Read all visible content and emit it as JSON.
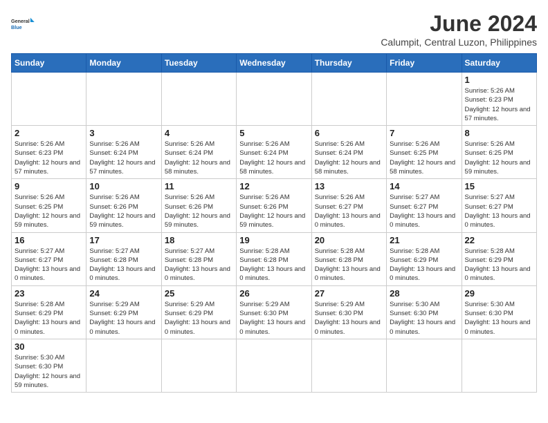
{
  "logo": {
    "text_general": "General",
    "text_blue": "Blue"
  },
  "header": {
    "title": "June 2024",
    "subtitle": "Calumpit, Central Luzon, Philippines"
  },
  "weekdays": [
    "Sunday",
    "Monday",
    "Tuesday",
    "Wednesday",
    "Thursday",
    "Friday",
    "Saturday"
  ],
  "weeks": [
    [
      {
        "day": "",
        "info": ""
      },
      {
        "day": "",
        "info": ""
      },
      {
        "day": "",
        "info": ""
      },
      {
        "day": "",
        "info": ""
      },
      {
        "day": "",
        "info": ""
      },
      {
        "day": "",
        "info": ""
      },
      {
        "day": "1",
        "info": "Sunrise: 5:26 AM\nSunset: 6:23 PM\nDaylight: 12 hours\nand 57 minutes."
      }
    ],
    [
      {
        "day": "2",
        "info": "Sunrise: 5:26 AM\nSunset: 6:23 PM\nDaylight: 12 hours\nand 57 minutes."
      },
      {
        "day": "3",
        "info": "Sunrise: 5:26 AM\nSunset: 6:24 PM\nDaylight: 12 hours\nand 57 minutes."
      },
      {
        "day": "4",
        "info": "Sunrise: 5:26 AM\nSunset: 6:24 PM\nDaylight: 12 hours\nand 58 minutes."
      },
      {
        "day": "5",
        "info": "Sunrise: 5:26 AM\nSunset: 6:24 PM\nDaylight: 12 hours\nand 58 minutes."
      },
      {
        "day": "6",
        "info": "Sunrise: 5:26 AM\nSunset: 6:24 PM\nDaylight: 12 hours\nand 58 minutes."
      },
      {
        "day": "7",
        "info": "Sunrise: 5:26 AM\nSunset: 6:25 PM\nDaylight: 12 hours\nand 58 minutes."
      },
      {
        "day": "8",
        "info": "Sunrise: 5:26 AM\nSunset: 6:25 PM\nDaylight: 12 hours\nand 59 minutes."
      }
    ],
    [
      {
        "day": "9",
        "info": "Sunrise: 5:26 AM\nSunset: 6:25 PM\nDaylight: 12 hours\nand 59 minutes."
      },
      {
        "day": "10",
        "info": "Sunrise: 5:26 AM\nSunset: 6:26 PM\nDaylight: 12 hours\nand 59 minutes."
      },
      {
        "day": "11",
        "info": "Sunrise: 5:26 AM\nSunset: 6:26 PM\nDaylight: 12 hours\nand 59 minutes."
      },
      {
        "day": "12",
        "info": "Sunrise: 5:26 AM\nSunset: 6:26 PM\nDaylight: 12 hours\nand 59 minutes."
      },
      {
        "day": "13",
        "info": "Sunrise: 5:26 AM\nSunset: 6:27 PM\nDaylight: 13 hours\nand 0 minutes."
      },
      {
        "day": "14",
        "info": "Sunrise: 5:27 AM\nSunset: 6:27 PM\nDaylight: 13 hours\nand 0 minutes."
      },
      {
        "day": "15",
        "info": "Sunrise: 5:27 AM\nSunset: 6:27 PM\nDaylight: 13 hours\nand 0 minutes."
      }
    ],
    [
      {
        "day": "16",
        "info": "Sunrise: 5:27 AM\nSunset: 6:27 PM\nDaylight: 13 hours\nand 0 minutes."
      },
      {
        "day": "17",
        "info": "Sunrise: 5:27 AM\nSunset: 6:28 PM\nDaylight: 13 hours\nand 0 minutes."
      },
      {
        "day": "18",
        "info": "Sunrise: 5:27 AM\nSunset: 6:28 PM\nDaylight: 13 hours\nand 0 minutes."
      },
      {
        "day": "19",
        "info": "Sunrise: 5:28 AM\nSunset: 6:28 PM\nDaylight: 13 hours\nand 0 minutes."
      },
      {
        "day": "20",
        "info": "Sunrise: 5:28 AM\nSunset: 6:28 PM\nDaylight: 13 hours\nand 0 minutes."
      },
      {
        "day": "21",
        "info": "Sunrise: 5:28 AM\nSunset: 6:29 PM\nDaylight: 13 hours\nand 0 minutes."
      },
      {
        "day": "22",
        "info": "Sunrise: 5:28 AM\nSunset: 6:29 PM\nDaylight: 13 hours\nand 0 minutes."
      }
    ],
    [
      {
        "day": "23",
        "info": "Sunrise: 5:28 AM\nSunset: 6:29 PM\nDaylight: 13 hours\nand 0 minutes."
      },
      {
        "day": "24",
        "info": "Sunrise: 5:29 AM\nSunset: 6:29 PM\nDaylight: 13 hours\nand 0 minutes."
      },
      {
        "day": "25",
        "info": "Sunrise: 5:29 AM\nSunset: 6:29 PM\nDaylight: 13 hours\nand 0 minutes."
      },
      {
        "day": "26",
        "info": "Sunrise: 5:29 AM\nSunset: 6:30 PM\nDaylight: 13 hours\nand 0 minutes."
      },
      {
        "day": "27",
        "info": "Sunrise: 5:29 AM\nSunset: 6:30 PM\nDaylight: 13 hours\nand 0 minutes."
      },
      {
        "day": "28",
        "info": "Sunrise: 5:30 AM\nSunset: 6:30 PM\nDaylight: 13 hours\nand 0 minutes."
      },
      {
        "day": "29",
        "info": "Sunrise: 5:30 AM\nSunset: 6:30 PM\nDaylight: 13 hours\nand 0 minutes."
      }
    ],
    [
      {
        "day": "30",
        "info": "Sunrise: 5:30 AM\nSunset: 6:30 PM\nDaylight: 12 hours\nand 59 minutes."
      },
      {
        "day": "",
        "info": ""
      },
      {
        "day": "",
        "info": ""
      },
      {
        "day": "",
        "info": ""
      },
      {
        "day": "",
        "info": ""
      },
      {
        "day": "",
        "info": ""
      },
      {
        "day": "",
        "info": ""
      }
    ]
  ]
}
